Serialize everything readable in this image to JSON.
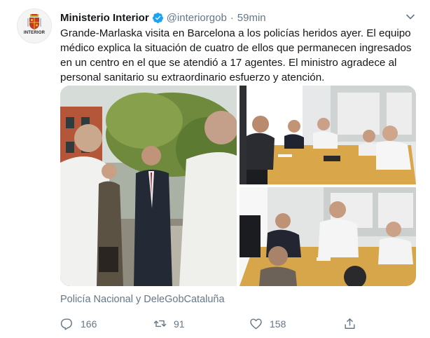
{
  "account": {
    "name": "Ministerio Interior",
    "handle": "@interiorgob",
    "separator": "·",
    "time": "59min",
    "avatar_text": "INTERIOR",
    "verified": true
  },
  "tweet": {
    "text": "Grande-Marlaska visita en Barcelona a los policías heridos ayer. El equipo médico explica la situación de cuatro de ellos que permanecen ingresados en un centro en el que se atendió a 17 agentes. El ministro agradece al personal sanitario su extraordinario esfuerzo y atención.",
    "tagged": "Policía Nacional y DeleGobCataluña"
  },
  "actions": {
    "replies": "166",
    "retweets": "91",
    "likes": "158"
  },
  "icons": {
    "reply": "reply-icon",
    "retweet": "retweet-icon",
    "like": "heart-icon",
    "share": "share-icon",
    "more": "chevron-down-icon",
    "verified": "verified-badge-icon"
  },
  "colors": {
    "text": "#14171a",
    "secondary": "#657786",
    "verified": "#1da1f2"
  }
}
